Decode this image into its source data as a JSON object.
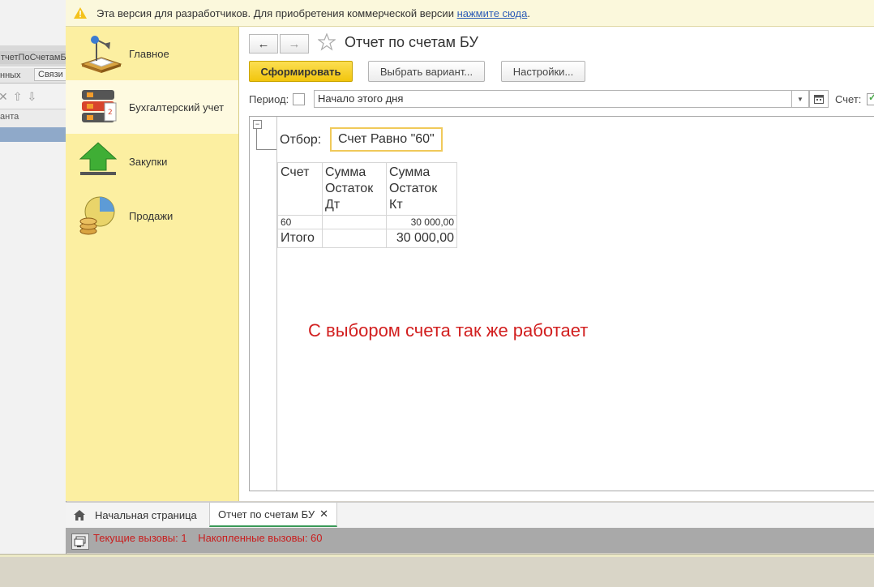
{
  "background_window": {
    "tab_title": "тчетПоСчетамБ",
    "tab_left": "нных",
    "tab_right": "Связи",
    "column_header": "анта"
  },
  "banner": {
    "text": "Эта версия для разработчиков. Для приобретения коммерческой версии ",
    "link": "нажмите сюда",
    "suffix": "."
  },
  "sections": [
    {
      "label": "Главное",
      "icon": "lamp-desk-icon"
    },
    {
      "label": "Бухгалтерский учет",
      "icon": "binders-icon"
    },
    {
      "label": "Закупки",
      "icon": "green-arrow-up-icon"
    },
    {
      "label": "Продажи",
      "icon": "coins-chart-icon"
    }
  ],
  "form": {
    "title": "Отчет по счетам БУ",
    "buttons": {
      "generate": "Сформировать",
      "choose_variant": "Выбрать вариант...",
      "settings": "Настройки..."
    },
    "period_label": "Период:",
    "period_value": "Начало этого дня",
    "account_label": "Счет:"
  },
  "report": {
    "filter_label": "Отбор:",
    "filter_value": "Счет Равно \"60\"",
    "headers": {
      "account": "Счет",
      "debit": "Сумма Остаток Дт",
      "credit": "Сумма Остаток Кт"
    },
    "rows": [
      {
        "account": "60",
        "debit": "",
        "credit": "30 000,00"
      }
    ],
    "total": {
      "label": "Итого",
      "debit": "",
      "credit": "30 000,00"
    },
    "comment": "С выбором счета так же работает"
  },
  "window_tabs": {
    "home": "Начальная страница",
    "report": "Отчет по счетам БУ"
  },
  "status": {
    "current_calls": "Текущие вызовы: 1",
    "accumulated_calls": "Накопленные вызовы: 60"
  },
  "colors": {
    "sections_bg": "#fcefa1",
    "primary_button": "#f2c50d",
    "comment_red": "#d21f1f",
    "active_tab_underline": "#3a9a58"
  }
}
